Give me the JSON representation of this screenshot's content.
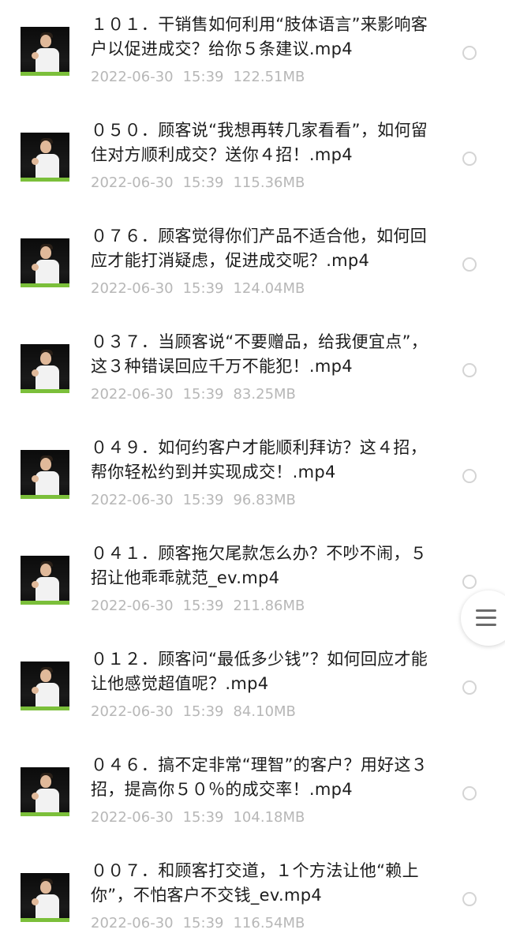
{
  "files": [
    {
      "title": "１０１．干销售如何利用“肢体语言”来影响客户以促进成交？给你５条建议.mp4",
      "date": "2022-06-30",
      "time": "15:39",
      "size": "122.51MB",
      "thumbnail_icon": "video-thumbnail-icon"
    },
    {
      "title": "０５０．顾客说“我想再转几家看看”，如何留住对方顺利成交？送你４招！.mp4",
      "date": "2022-06-30",
      "time": "15:39",
      "size": "115.36MB",
      "thumbnail_icon": "video-thumbnail-icon"
    },
    {
      "title": "０７６．顾客觉得你们产品不适合他，如何回应才能打消疑虑，促进成交呢？.mp4",
      "date": "2022-06-30",
      "time": "15:39",
      "size": "124.04MB",
      "thumbnail_icon": "video-thumbnail-icon"
    },
    {
      "title": "０３７．当顾客说“不要赠品，给我便宜点”，这３种错误回应千万不能犯！.mp4",
      "date": "2022-06-30",
      "time": "15:39",
      "size": "83.25MB",
      "thumbnail_icon": "video-thumbnail-icon"
    },
    {
      "title": "０４９．如何约客户才能顺利拜访？这４招，帮你轻松约到并实现成交！.mp4",
      "date": "2022-06-30",
      "time": "15:39",
      "size": "96.83MB",
      "thumbnail_icon": "video-thumbnail-icon"
    },
    {
      "title": "０４１．顾客拖欠尾款怎么办？不吵不闹，５招让他乖乖就范_ev.mp4",
      "date": "2022-06-30",
      "time": "15:39",
      "size": "211.86MB",
      "thumbnail_icon": "video-thumbnail-icon"
    },
    {
      "title": "０１２．顾客问“最低多少钱”？如何回应才能让他感觉超值呢？.mp4",
      "date": "2022-06-30",
      "time": "15:39",
      "size": "84.10MB",
      "thumbnail_icon": "video-thumbnail-icon"
    },
    {
      "title": "０４６．搞不定非常“理智”的客户？用好这３招，提高你５０％的成交率！.mp4",
      "date": "2022-06-30",
      "time": "15:39",
      "size": "104.18MB",
      "thumbnail_icon": "video-thumbnail-icon"
    },
    {
      "title": "００７．和顾客打交道，１个方法让他“赖上你”，不怕客户不交钱_ev.mp4",
      "date": "2022-06-30",
      "time": "15:39",
      "size": "116.54MB",
      "thumbnail_icon": "video-thumbnail-icon"
    }
  ],
  "side_menu": {
    "icon": "hamburger-menu-icon"
  },
  "colors": {
    "title": "#1c1c1c",
    "meta": "#b7b7b7",
    "radio_border": "#d4d4d4",
    "thumbnail_grass": "#7bbf3a"
  }
}
